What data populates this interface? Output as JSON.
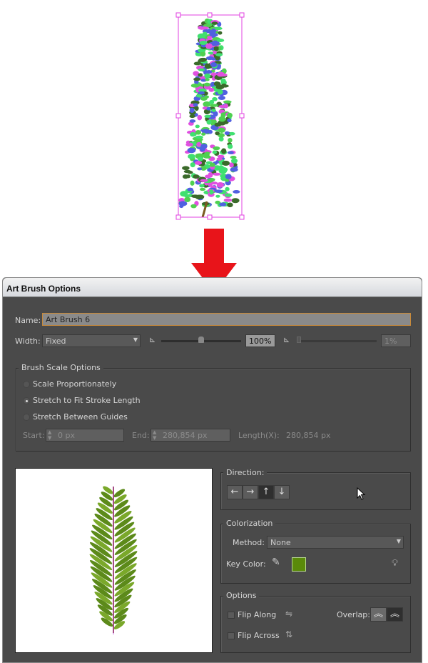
{
  "dialog": {
    "title": "Art Brush Options"
  },
  "name": {
    "label": "Name:",
    "value": "Art Brush 6"
  },
  "width": {
    "label": "Width:",
    "value": "Fixed",
    "percent": "100%",
    "variation": "1%"
  },
  "brush_scale": {
    "title": "Brush Scale Options",
    "options": [
      {
        "label": "Scale Proportionately",
        "selected": false
      },
      {
        "label": "Stretch to Fit Stroke Length",
        "selected": true
      },
      {
        "label": "Stretch Between Guides",
        "selected": false
      }
    ],
    "start_label": "Start:",
    "start_value": "0 px",
    "end_label": "End:",
    "end_value": "280,854 px",
    "length_label": "Length(X):",
    "length_value": "280,854 px"
  },
  "direction": {
    "title": "Direction:",
    "buttons": [
      "←",
      "→",
      "↑",
      "↓"
    ],
    "selected": "↑"
  },
  "colorization": {
    "title": "Colorization",
    "method_label": "Method:",
    "method_value": "None",
    "key_color_label": "Key Color:",
    "key_color": "#5a8a0a"
  },
  "options": {
    "title": "Options",
    "flip_along": "Flip Along",
    "flip_across": "Flip Across",
    "overlap_label": "Overlap:"
  },
  "colors": {
    "arrow": "#e8141a",
    "selection": "#e040e0"
  }
}
